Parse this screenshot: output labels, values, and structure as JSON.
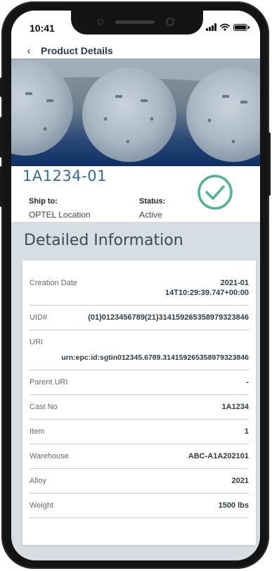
{
  "status_bar": {
    "time": "10:41",
    "icons": [
      "signal-icon",
      "wifi-icon",
      "battery-icon"
    ]
  },
  "header": {
    "back_icon": "chevron-left-icon",
    "back_glyph": "‹",
    "title": "Product Details"
  },
  "summary": {
    "product_id": "1A1234-01",
    "ship_to_label": "Ship to:",
    "ship_to_value": "OPTEL Location",
    "status_label": "Status:",
    "status_value": "Active",
    "status_icon": "check-circle-icon",
    "status_color": "#4fb58a"
  },
  "details": {
    "title": "Detailed Information",
    "rows": [
      {
        "label": "Creation Date",
        "value_line1": "2021-01",
        "value_line2": "14T10:29:39.747+00:00"
      },
      {
        "label": "UID#",
        "value": "(01)0123456789(21)31415926535897932384​6"
      },
      {
        "label": "URI",
        "value": "urn:epc:id:sgtin012345.6789.314159265358979323846"
      },
      {
        "label": "Parent URI",
        "value": "-"
      },
      {
        "label": "Cast No",
        "value": "1A1234"
      },
      {
        "label": "Item",
        "value": "1"
      },
      {
        "label": "Warehouse",
        "value": "ABC-A1A202101"
      },
      {
        "label": "Alloy",
        "value": "2021"
      },
      {
        "label": "Weight",
        "value": "1500 lbs"
      }
    ]
  },
  "colors": {
    "accent": "#2f6ca0",
    "background": "#d6dde3",
    "check": "#4fb58a"
  }
}
